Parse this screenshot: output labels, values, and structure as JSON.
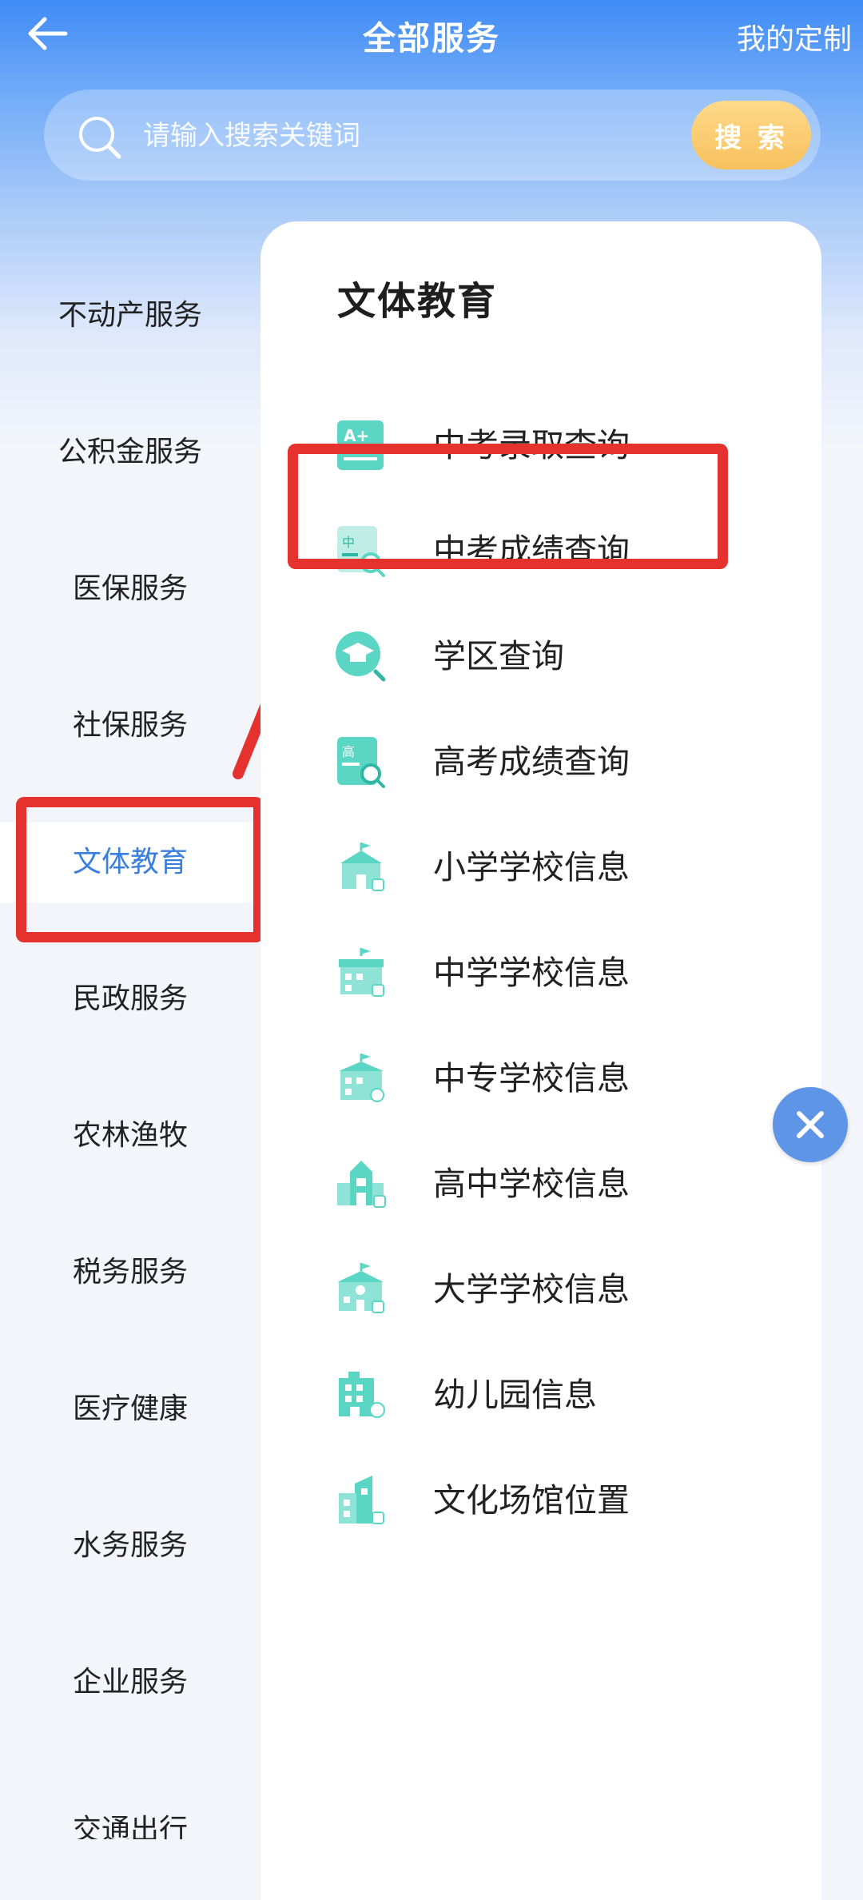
{
  "header": {
    "title": "全部服务",
    "custom_label": "我的定制"
  },
  "search": {
    "placeholder": "请输入搜索关键词",
    "button_label": "搜 索"
  },
  "sidebar": {
    "items": [
      {
        "label": "不动产服务"
      },
      {
        "label": "公积金服务"
      },
      {
        "label": "医保服务"
      },
      {
        "label": "社保服务"
      },
      {
        "label": "文体教育"
      },
      {
        "label": "民政服务"
      },
      {
        "label": "农林渔牧"
      },
      {
        "label": "税务服务"
      },
      {
        "label": "医疗健康"
      },
      {
        "label": "水务服务"
      },
      {
        "label": "企业服务"
      },
      {
        "label": "交通出行"
      }
    ],
    "active_index": 4
  },
  "panel": {
    "title": "文体教育",
    "services": [
      {
        "label": "中考录取查询",
        "icon": "score-sheet-icon"
      },
      {
        "label": "中考成绩查询",
        "icon": "zhong-search-icon"
      },
      {
        "label": "学区查询",
        "icon": "graduation-search-icon"
      },
      {
        "label": "高考成绩查询",
        "icon": "gao-search-icon"
      },
      {
        "label": "小学学校信息",
        "icon": "school-building-icon"
      },
      {
        "label": "中学学校信息",
        "icon": "school-building-icon"
      },
      {
        "label": "中专学校信息",
        "icon": "school-building-icon"
      },
      {
        "label": "高中学校信息",
        "icon": "school-building-icon"
      },
      {
        "label": "大学学校信息",
        "icon": "school-building-icon"
      },
      {
        "label": "幼儿园信息",
        "icon": "kindergarten-icon"
      },
      {
        "label": "文化场馆位置",
        "icon": "venue-building-icon"
      }
    ],
    "icon_glyphs": {
      "score": "A+",
      "zhong": "中",
      "gao": "高"
    }
  },
  "colors": {
    "accent": "#3a7fe0",
    "icon_teal": "#5cd6c4",
    "highlight_red": "#e5322e",
    "search_button": "#f7c15d"
  }
}
